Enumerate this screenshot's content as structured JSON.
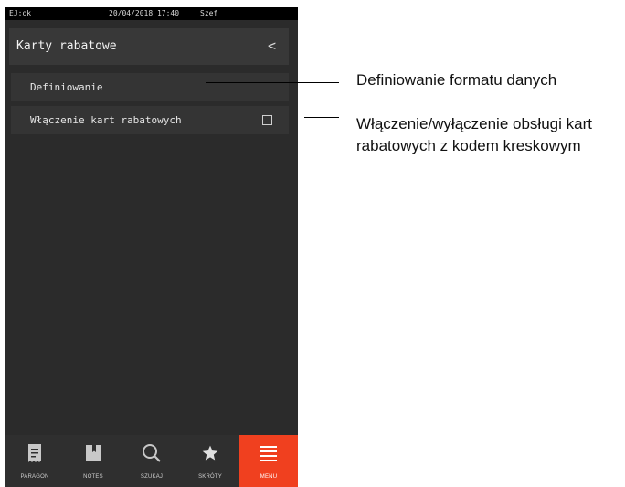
{
  "status_bar": {
    "ej": "EJ:ok",
    "datetime": "20/04/2018 17:40",
    "user": "Szef"
  },
  "header": {
    "title": "Karty rabatowe",
    "back_glyph": "<"
  },
  "menu_items": [
    {
      "label": "Definiowanie"
    },
    {
      "label": "Włączenie kart rabatowych",
      "checked": false
    }
  ],
  "navbar": [
    {
      "label": "PARAGON",
      "icon": "receipt-icon"
    },
    {
      "label": "NOTES",
      "icon": "notebook-icon"
    },
    {
      "label": "SZUKAJ",
      "icon": "search-icon"
    },
    {
      "label": "SKRÓTY",
      "icon": "star-icon"
    },
    {
      "label": "MENU",
      "icon": "menu-icon",
      "active": true
    }
  ],
  "callouts": [
    {
      "text": "Definiowanie formatu danych"
    },
    {
      "text": "Włączenie/wyłączenie obsługi kart rabatowych z kodem kreskowym"
    }
  ],
  "colors": {
    "accent": "#f0401f",
    "screen_bg": "#2b2b2b",
    "row_bg": "#343434"
  }
}
